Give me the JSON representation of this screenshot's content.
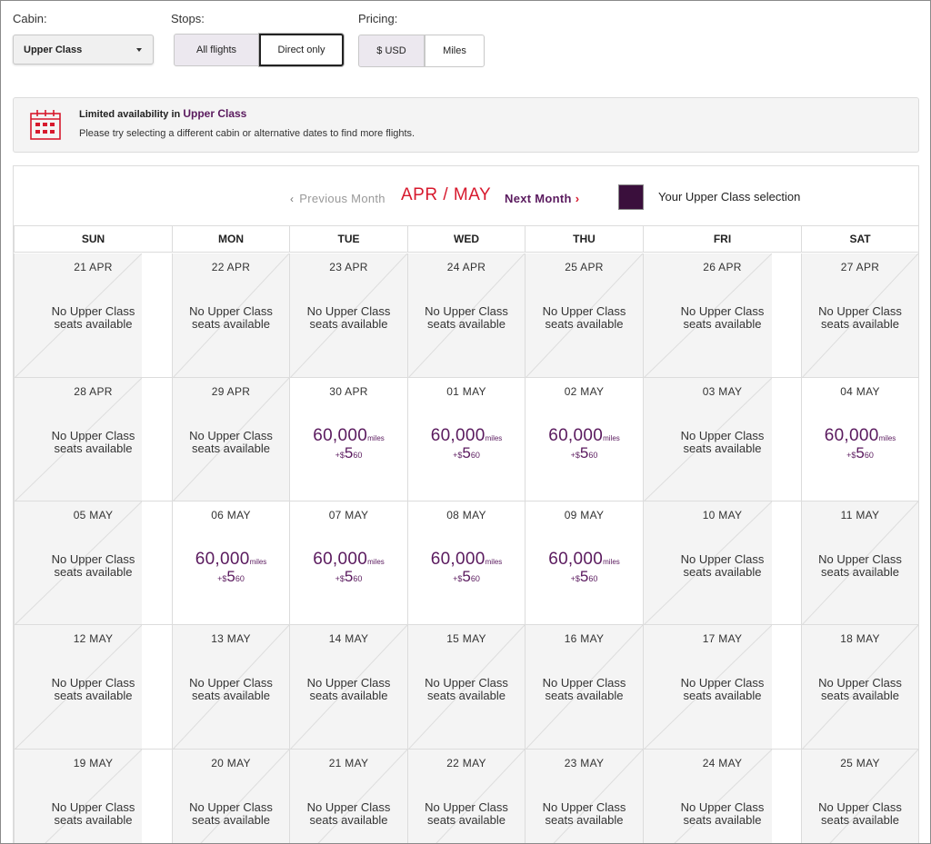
{
  "filters": {
    "cabin_label": "Cabin:",
    "cabin_value": "Upper Class",
    "stops_label": "Stops:",
    "stops_options": [
      "All flights",
      "Direct only"
    ],
    "pricing_label": "Pricing:",
    "pricing_options": [
      "$ USD",
      "Miles"
    ]
  },
  "banner": {
    "title_prefix": "Limited availability in",
    "title_highlight": "Upper Class",
    "message": "Please try selecting a different cabin or alternative dates to find more flights."
  },
  "nav": {
    "prev_label": "Previous Month",
    "month_label": "APR / MAY",
    "next_label": "Next Month"
  },
  "legend": {
    "label": "Your Upper Class selection",
    "color": "#3a0f3c"
  },
  "weekdays": [
    "SUN",
    "MON",
    "TUE",
    "WED",
    "THU",
    "FRI",
    "SAT"
  ],
  "na_message_line1": "No Upper Class",
  "na_message_line2": "seats available",
  "fare": {
    "miles": "60,000",
    "miles_unit": "miles",
    "fee_prefix": "+$",
    "fee_dollars": "5",
    "fee_cents": "60"
  },
  "weeks": [
    [
      {
        "date": "21 APR",
        "available": false
      },
      {
        "date": "22 APR",
        "available": false
      },
      {
        "date": "23 APR",
        "available": false
      },
      {
        "date": "24 APR",
        "available": false
      },
      {
        "date": "25 APR",
        "available": false
      },
      {
        "date": "26 APR",
        "available": false
      },
      {
        "date": "27 APR",
        "available": false
      }
    ],
    [
      {
        "date": "28 APR",
        "available": false
      },
      {
        "date": "29 APR",
        "available": false
      },
      {
        "date": "30 APR",
        "available": true
      },
      {
        "date": "01 MAY",
        "available": true
      },
      {
        "date": "02 MAY",
        "available": true
      },
      {
        "date": "03 MAY",
        "available": false
      },
      {
        "date": "04 MAY",
        "available": true
      }
    ],
    [
      {
        "date": "05 MAY",
        "available": false
      },
      {
        "date": "06 MAY",
        "available": true
      },
      {
        "date": "07 MAY",
        "available": true
      },
      {
        "date": "08 MAY",
        "available": true
      },
      {
        "date": "09 MAY",
        "available": true
      },
      {
        "date": "10 MAY",
        "available": false
      },
      {
        "date": "11 MAY",
        "available": false
      }
    ],
    [
      {
        "date": "12 MAY",
        "available": false
      },
      {
        "date": "13 MAY",
        "available": false
      },
      {
        "date": "14 MAY",
        "available": false
      },
      {
        "date": "15 MAY",
        "available": false
      },
      {
        "date": "16 MAY",
        "available": false
      },
      {
        "date": "17 MAY",
        "available": false
      },
      {
        "date": "18 MAY",
        "available": false
      }
    ],
    [
      {
        "date": "19 MAY",
        "available": false
      },
      {
        "date": "20 MAY",
        "available": false
      },
      {
        "date": "21 MAY",
        "available": false
      },
      {
        "date": "22 MAY",
        "available": false
      },
      {
        "date": "23 MAY",
        "available": false
      },
      {
        "date": "24 MAY",
        "available": false
      },
      {
        "date": "25 MAY",
        "available": false
      }
    ]
  ],
  "colors": {
    "brand_purple": "#5a1a5e",
    "accent_red": "#d7192d",
    "unavailable_bg": "#f4f4f4"
  }
}
